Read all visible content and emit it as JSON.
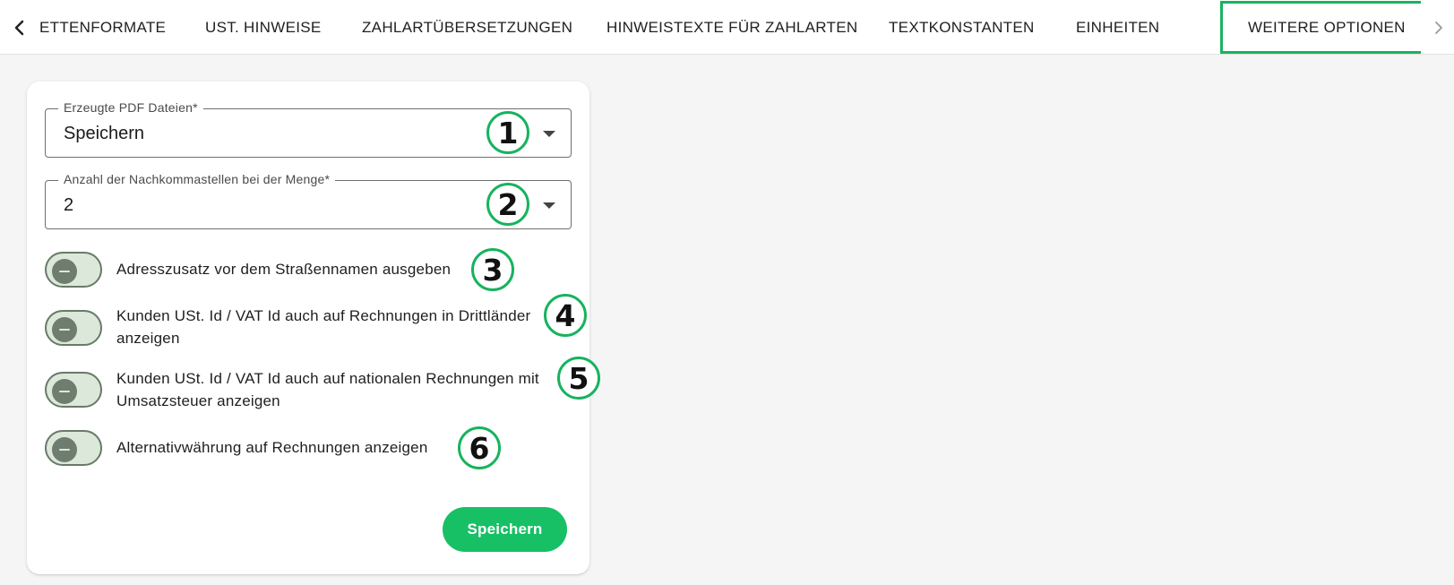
{
  "tabs": [
    {
      "label": "ETTENFORMATE",
      "active": false
    },
    {
      "label": "UST. HINWEISE",
      "active": false
    },
    {
      "label": "ZAHLARTÜBERSETZUNGEN",
      "active": false
    },
    {
      "label": "HINWEISTEXTE FÜR ZAHLARTEN",
      "active": false
    },
    {
      "label": "TEXTKONSTANTEN",
      "active": false
    },
    {
      "label": "EINHEITEN",
      "active": false
    },
    {
      "label": "WEITERE OPTIONEN",
      "active": true
    }
  ],
  "form": {
    "pdf_select": {
      "label": "Erzeugte PDF Dateien*",
      "value": "Speichern"
    },
    "decimals_select": {
      "label": "Anzahl der Nachkommastellen bei der Menge*",
      "value": "2"
    },
    "toggles": [
      {
        "label": "Adresszusatz vor dem Straßennamen ausgeben",
        "checked": false
      },
      {
        "label": "Kunden USt. Id / VAT Id auch auf Rechnungen in Drittländer anzeigen",
        "checked": false
      },
      {
        "label": "Kunden USt. Id / VAT Id auch auf nationalen Rechnungen mit Umsatzsteuer anzeigen",
        "checked": false
      },
      {
        "label": "Alternativwährung auf Rechnungen anzeigen",
        "checked": false
      }
    ],
    "save_label": "Speichern"
  },
  "badges": [
    "1",
    "2",
    "3",
    "4",
    "5",
    "6"
  ],
  "icons": {
    "left": "chevron-left-icon",
    "right": "chevron-right-icon",
    "dropdown": "caret-down-icon"
  },
  "colors": {
    "accent": "#17b35e",
    "button": "#17c065",
    "toggle_track": "#dbe8da",
    "toggle_knob": "#6e7d6e"
  }
}
